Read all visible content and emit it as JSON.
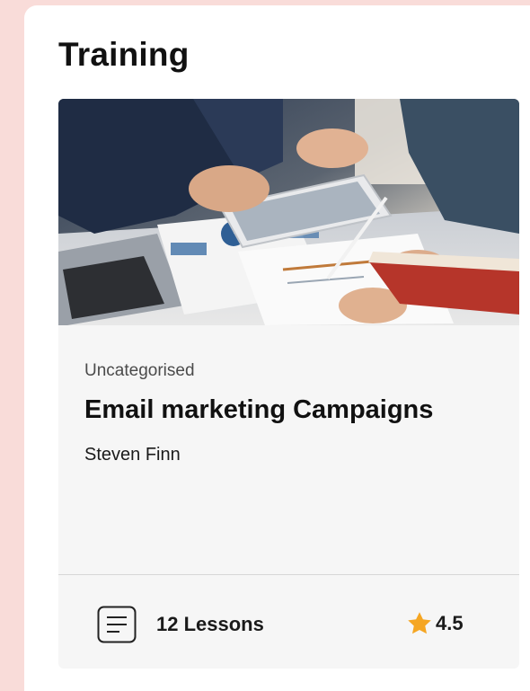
{
  "section": {
    "title": "Training"
  },
  "course": {
    "image_alt": "business team reviewing charts on a tablet",
    "category": "Uncategorised",
    "title": "Email marketing Campaigns",
    "author": "Steven Finn",
    "lessons_label": "12 Lessons",
    "rating": "4.5"
  },
  "icons": {
    "lessons": "document-lines-icon",
    "rating": "star-icon"
  },
  "colors": {
    "page_background": "#f9dcd9",
    "card_background": "#f6f6f6",
    "star": "#f5a623",
    "text": "#111111"
  }
}
